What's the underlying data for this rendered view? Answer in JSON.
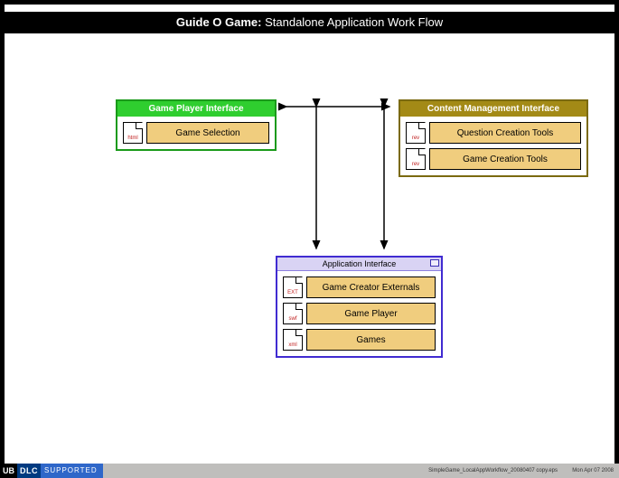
{
  "title": {
    "bold": "Guide O Game:",
    "rest": " Standalone Application Work Flow"
  },
  "nodes": {
    "gpi": {
      "header": "Game Player Interface",
      "items": [
        {
          "icon": "html",
          "label": "Game Selection"
        }
      ]
    },
    "cmi": {
      "header": "Content Management Interface",
      "items": [
        {
          "icon": "rev",
          "label": "Question Creation Tools"
        },
        {
          "icon": "rev",
          "label": "Game Creation Tools"
        }
      ]
    },
    "app": {
      "title": "Application Interface",
      "items": [
        {
          "icon": "EXT",
          "label": "Game Creator Externals"
        },
        {
          "icon": "swf",
          "label": "Game Player"
        },
        {
          "icon": "xml",
          "label": "Games"
        }
      ]
    }
  },
  "footer": {
    "brand_ub": "UB",
    "brand_dlc": "DLC",
    "brand_support": "SUPPORTED",
    "file": "SimpleGame_LocalAppWorkflow_20080407 copy.eps",
    "date": "Mon Apr 07 2008"
  }
}
